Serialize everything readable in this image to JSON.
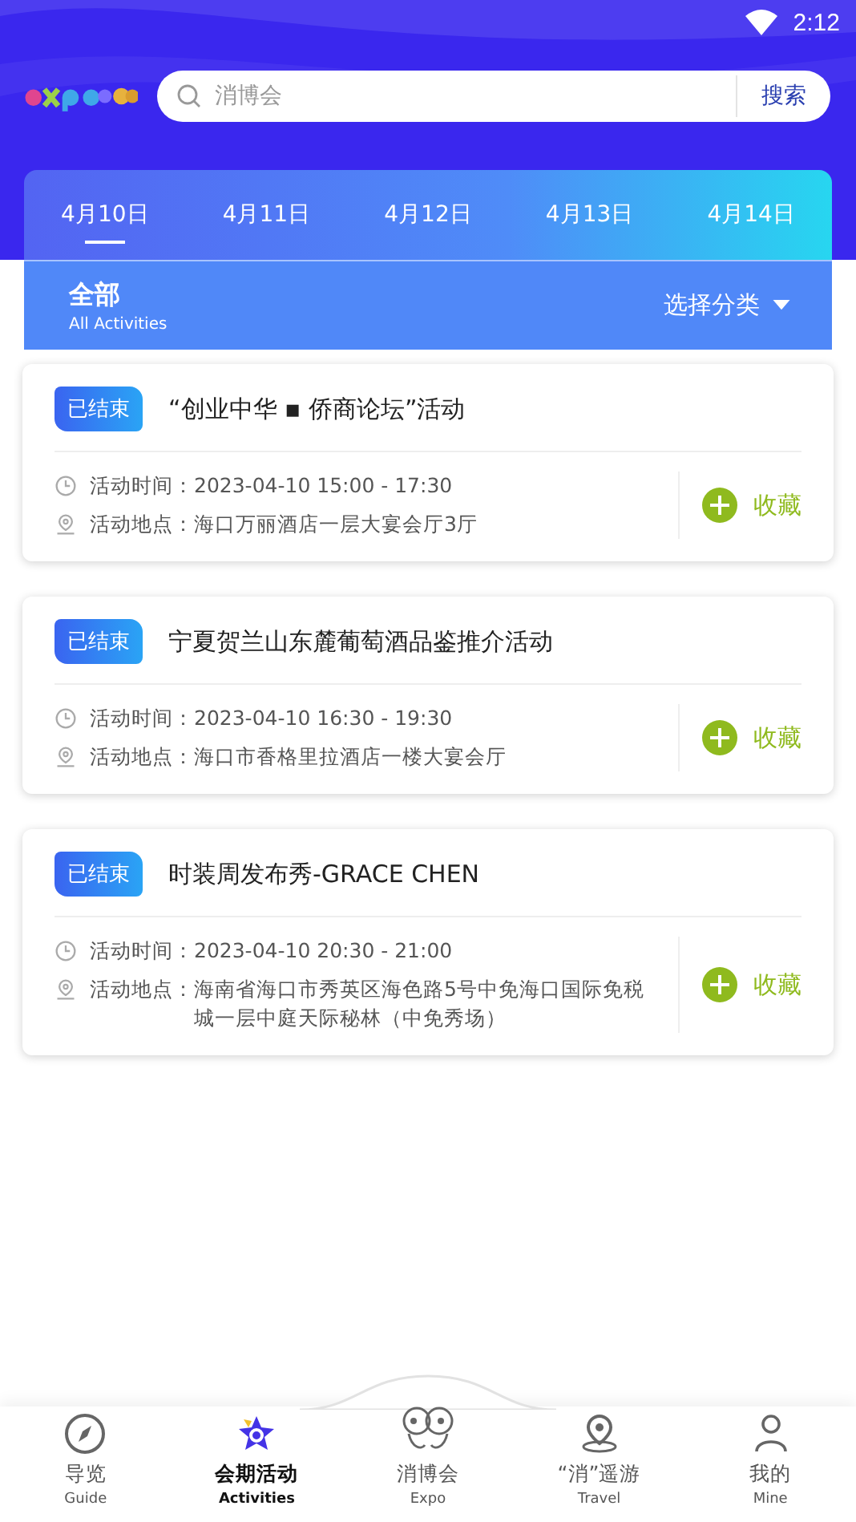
{
  "status_bar": {
    "time": "2:12"
  },
  "search": {
    "placeholder": "消博会",
    "button": "搜索"
  },
  "dates": [
    {
      "label": "4月10日",
      "selected": true
    },
    {
      "label": "4月11日",
      "selected": false
    },
    {
      "label": "4月12日",
      "selected": false
    },
    {
      "label": "4月13日",
      "selected": false
    },
    {
      "label": "4月14日",
      "selected": false
    }
  ],
  "category": {
    "title": "全部",
    "subtitle": "All Activities",
    "filter": "选择分类"
  },
  "events": [
    {
      "status": "已结束",
      "title": "“创业中华 ▪ 侨商论坛”活动",
      "time_label": "活动时间：",
      "time": "2023-04-10 15:00 - 17:30",
      "place_label": "活动地点：",
      "place": "海口万丽酒店一层大宴会厅3厅",
      "favorite": "收藏"
    },
    {
      "status": "已结束",
      "title": "宁夏贺兰山东麓葡萄酒品鉴推介活动",
      "time_label": "活动时间：",
      "time": "2023-04-10 16:30 - 19:30",
      "place_label": "活动地点：",
      "place": "海口市香格里拉酒店一楼大宴会厅",
      "favorite": "收藏"
    },
    {
      "status": "已结束",
      "title": "时装周发布秀-GRACE CHEN",
      "time_label": "活动时间：",
      "time": "2023-04-10 20:30 - 21:00",
      "place_label": "活动地点：",
      "place": "海南省海口市秀英区海色路5号中免海口国际免税城一层中庭天际秘林（中免秀场）",
      "favorite": "收藏"
    }
  ],
  "nav": [
    {
      "kind": "compass",
      "label": "导览",
      "sub": "Guide",
      "selected": false
    },
    {
      "kind": "star",
      "label": "会期活动",
      "sub": "Activities",
      "selected": true
    },
    {
      "kind": "mascot",
      "label": "消博会",
      "sub": "Expo",
      "selected": false
    },
    {
      "kind": "pin",
      "label": "“消”遥游",
      "sub": "Travel",
      "selected": false
    },
    {
      "kind": "person",
      "label": "我的",
      "sub": "Mine",
      "selected": false
    }
  ]
}
